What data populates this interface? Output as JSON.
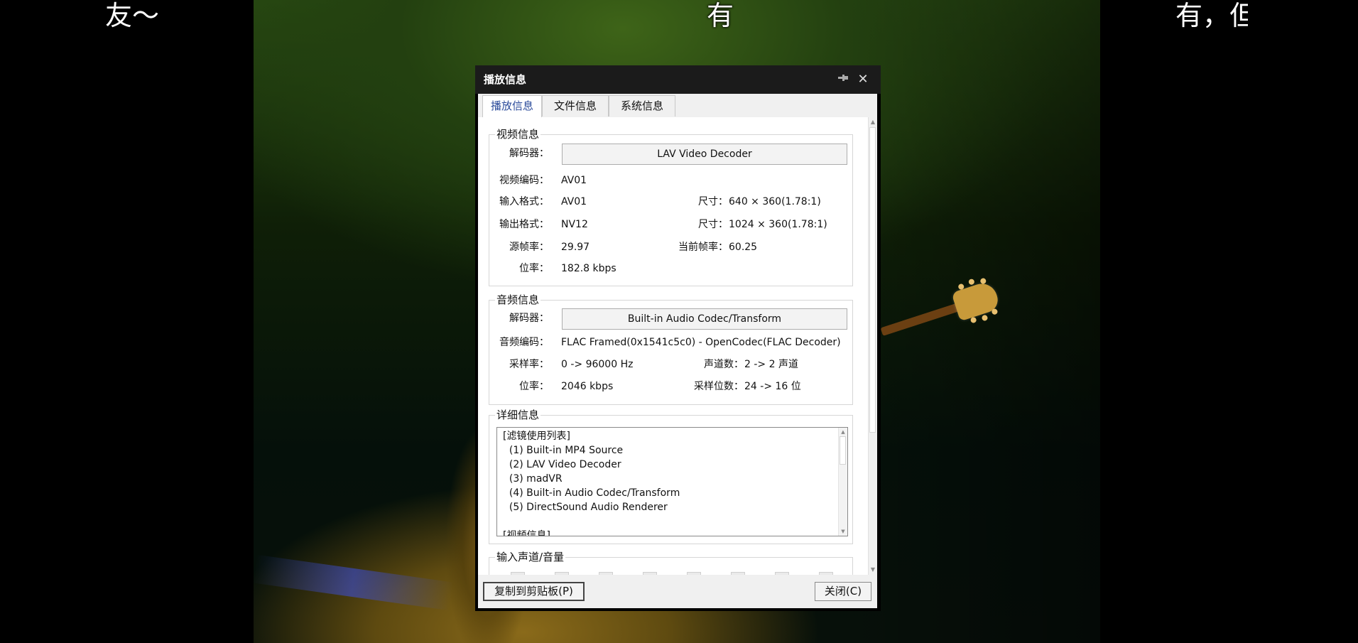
{
  "video": {
    "subtitles": [
      "友～",
      "有",
      "有，但"
    ]
  },
  "dialog": {
    "title": "播放信息",
    "icons": {
      "pin": "pin-icon",
      "close": "close-icon"
    },
    "tabs": [
      {
        "label": "播放信息",
        "active": true
      },
      {
        "label": "文件信息",
        "active": false
      },
      {
        "label": "系统信息",
        "active": false
      }
    ],
    "video_info": {
      "title": "视频信息",
      "decoder_label": "解码器：",
      "decoder_value": "LAV Video Decoder",
      "codec_label": "视频编码：",
      "codec_value": "AV01",
      "input_format_label": "输入格式：",
      "input_format_value": "AV01",
      "input_size_label": "尺寸：",
      "input_size_value": "640 × 360(1.78:1)",
      "output_format_label": "输出格式：",
      "output_format_value": "NV12",
      "output_size_label": "尺寸：",
      "output_size_value": "1024 × 360(1.78:1)",
      "source_fps_label": "源帧率：",
      "source_fps_value": "29.97",
      "current_fps_label": "当前帧率：",
      "current_fps_value": "60.25",
      "bitrate_label": "位率：",
      "bitrate_value": "182.8 kbps"
    },
    "audio_info": {
      "title": "音频信息",
      "decoder_label": "解码器：",
      "decoder_value": "Built-in Audio Codec/Transform",
      "codec_label": "音频编码：",
      "codec_value": "FLAC Framed(0x1541c5c0) - OpenCodec(FLAC Decoder)",
      "samplerate_label": "采样率：",
      "samplerate_value": "0 -> 96000 Hz",
      "channels_label": "声道数：",
      "channels_value": "2 -> 2 声道",
      "bitrate_label": "位率：",
      "bitrate_value": "2046 kbps",
      "bits_label": "采样位数：",
      "bits_value": "24 -> 16 位"
    },
    "details": {
      "title": "详细信息",
      "lines": [
        "[滤镜使用列表]",
        "  (1) Built-in MP4 Source",
        "  (2) LAV Video Decoder",
        "  (3) madVR",
        "  (4) Built-in Audio Codec/Transform",
        "  (5) DirectSound Audio Renderer",
        "",
        "[视频信息]"
      ]
    },
    "input_channels": {
      "title": "输入声道/音量"
    },
    "buttons": {
      "copy": "复制到剪贴板(P)",
      "close": "关闭(C)"
    }
  }
}
